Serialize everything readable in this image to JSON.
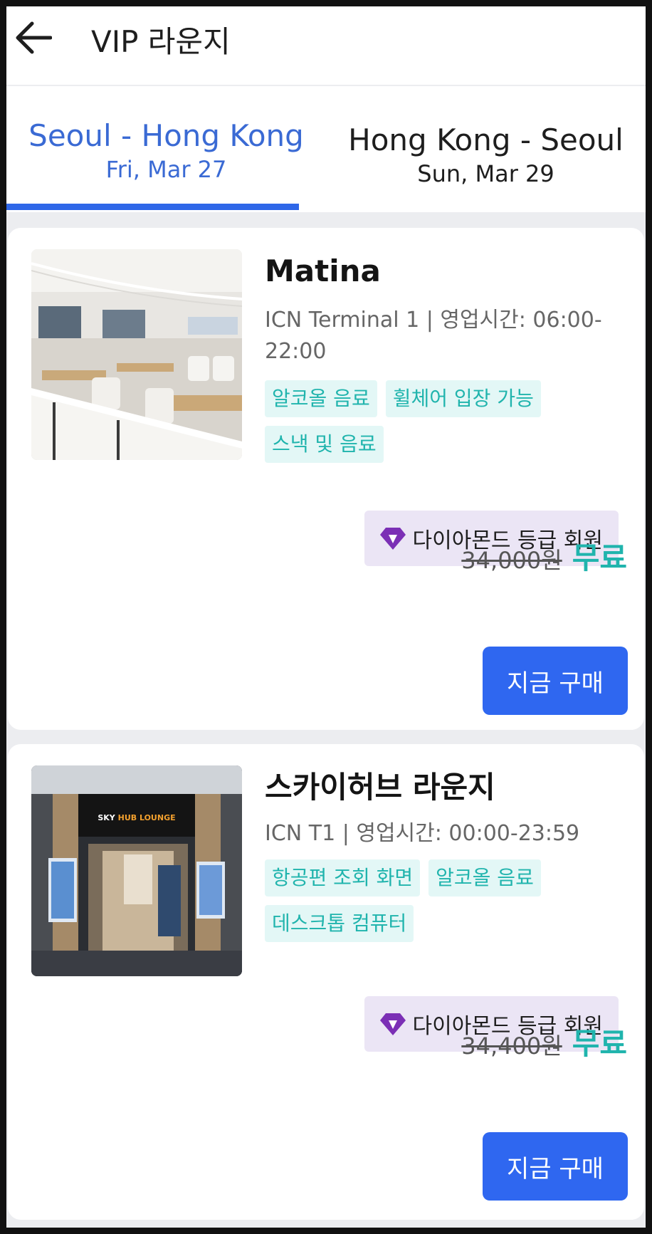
{
  "header": {
    "title": "VIP 라운지",
    "back_icon": "arrow-left-icon"
  },
  "tabs": [
    {
      "route": "Seoul - Hong Kong",
      "date": "Fri, Mar 27",
      "active": true
    },
    {
      "route": "Hong Kong - Seoul",
      "date": "Sun, Mar 29",
      "active": false
    }
  ],
  "colors": {
    "accent": "#2f67e8",
    "tag_text": "#20b4ad",
    "tag_bg": "#e3f7f6",
    "member_bg": "#ebe5f5",
    "diamond": "#7b2fb5"
  },
  "lounges": [
    {
      "name": "Matina",
      "location": "ICN Terminal 1 | 영업시간: 06:00-22:00",
      "tags": [
        "알코올 음료",
        "휠체어 입장 가능",
        "스낵 및 음료"
      ],
      "membership": "다이아몬드 등급 회원",
      "original_price": "34,000원",
      "price": "무료",
      "buy_label": "지금 구매"
    },
    {
      "name": "스카이허브 라운지",
      "location": "ICN T1 | 영업시간: 00:00-23:59",
      "tags": [
        "항공편 조회 화면",
        "알코올 음료",
        "데스크톱 컴퓨터"
      ],
      "membership": "다이아몬드 등급 회원",
      "original_price": "34,400원",
      "price": "무료",
      "buy_label": "지금 구매",
      "signage": "SKY HUB LOUNGE"
    }
  ]
}
